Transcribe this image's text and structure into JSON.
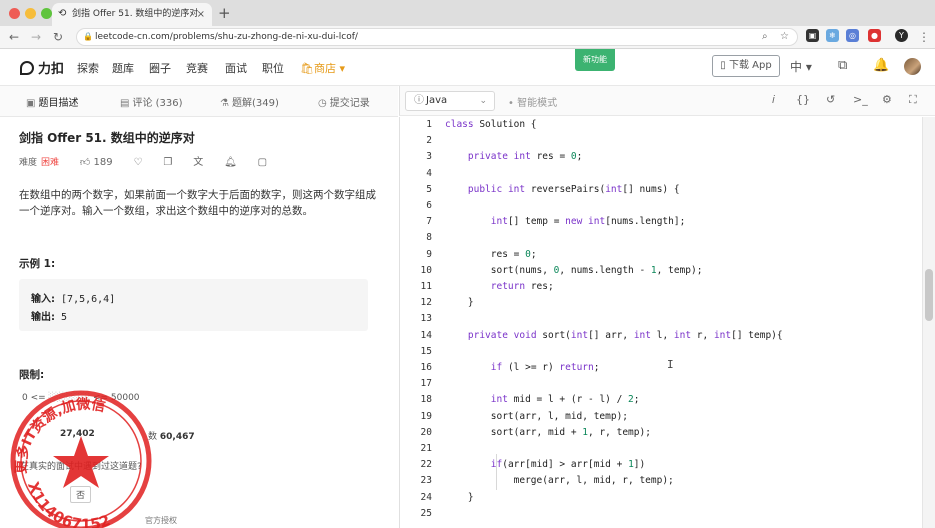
{
  "browser": {
    "tab_title": "剑指 Offer 51. 数组中的逆序对",
    "url": "leetcode-cn.com/problems/shu-zu-zhong-de-ni-xu-dui-lcof/",
    "new_tab": "+",
    "tab_close": "×",
    "profile_letter": "Y"
  },
  "header": {
    "logo": "力扣",
    "nav": [
      "探索",
      "题库",
      "圈子",
      "竞赛",
      "面试",
      "职位"
    ],
    "store": "商店",
    "new_feature": "新功能",
    "download_app": "下载 App",
    "lang": "中"
  },
  "left_tabs": [
    {
      "label": "题目描述"
    },
    {
      "label": "评论 (336)"
    },
    {
      "label": "题解(349)"
    },
    {
      "label": "提交记录"
    }
  ],
  "problem": {
    "title": "剑指 Offer 51. 数组中的逆序对",
    "difficulty_label": "难度",
    "difficulty": "困难",
    "likes": "189",
    "description": "在数组中的两个数字，如果前面一个数字大于后面的数字，则这两个数字组成一个逆序对。输入一个数组，求出这个数组中的逆序对的总数。",
    "example_title": "示例 1:",
    "example_input_label": "输入:",
    "example_input": "[7,5,6,4]",
    "example_output_label": "输出:",
    "example_output": "5",
    "limits_title": "限制:",
    "limit_prefix": "0 <=",
    "limit_suffix": "<= 50000",
    "passed_count": "27,402",
    "submit_label": "数",
    "submit_count": "60,467",
    "interview_q": "在真实的面试中遇到过这道题?",
    "no_label": "否",
    "official_sponsor": "官方授权"
  },
  "editor": {
    "language": "Java",
    "smart_mode": "智能模式",
    "lines": [
      {
        "n": "1",
        "t": "class Solution {"
      },
      {
        "n": "2",
        "t": ""
      },
      {
        "n": "3",
        "t": "    private int res = 0;"
      },
      {
        "n": "4",
        "t": ""
      },
      {
        "n": "5",
        "t": "    public int reversePairs(int[] nums) {"
      },
      {
        "n": "6",
        "t": ""
      },
      {
        "n": "7",
        "t": "        int[] temp = new int[nums.length];"
      },
      {
        "n": "8",
        "t": ""
      },
      {
        "n": "9",
        "t": "        res = 0;"
      },
      {
        "n": "10",
        "t": "        sort(nums, 0, nums.length - 1, temp);"
      },
      {
        "n": "11",
        "t": "        return res;"
      },
      {
        "n": "12",
        "t": "    }"
      },
      {
        "n": "13",
        "t": ""
      },
      {
        "n": "14",
        "t": "    private void sort(int[] arr, int l, int r, int[] temp){"
      },
      {
        "n": "15",
        "t": ""
      },
      {
        "n": "16",
        "t": "        if (l >= r) return;"
      },
      {
        "n": "17",
        "t": ""
      },
      {
        "n": "18",
        "t": "        int mid = l + (r - l) / 2;"
      },
      {
        "n": "19",
        "t": "        sort(arr, l, mid, temp);"
      },
      {
        "n": "20",
        "t": "        sort(arr, mid + 1, r, temp);"
      },
      {
        "n": "21",
        "t": ""
      },
      {
        "n": "22",
        "t": "        if(arr[mid] > arr[mid + 1])"
      },
      {
        "n": "23",
        "t": "            merge(arr, l, mid, r, temp);"
      },
      {
        "n": "24",
        "t": "    }"
      },
      {
        "n": "25",
        "t": ""
      }
    ]
  },
  "watermark": {
    "text": "更多IT资源,加微信",
    "id": "X114067152"
  },
  "colors": {
    "difficulty_hard": "#ef4743",
    "keyword": "#7a33c9",
    "number": "#098658",
    "new_feature_bg": "#3cb371",
    "stamp_red": "#e02020"
  }
}
